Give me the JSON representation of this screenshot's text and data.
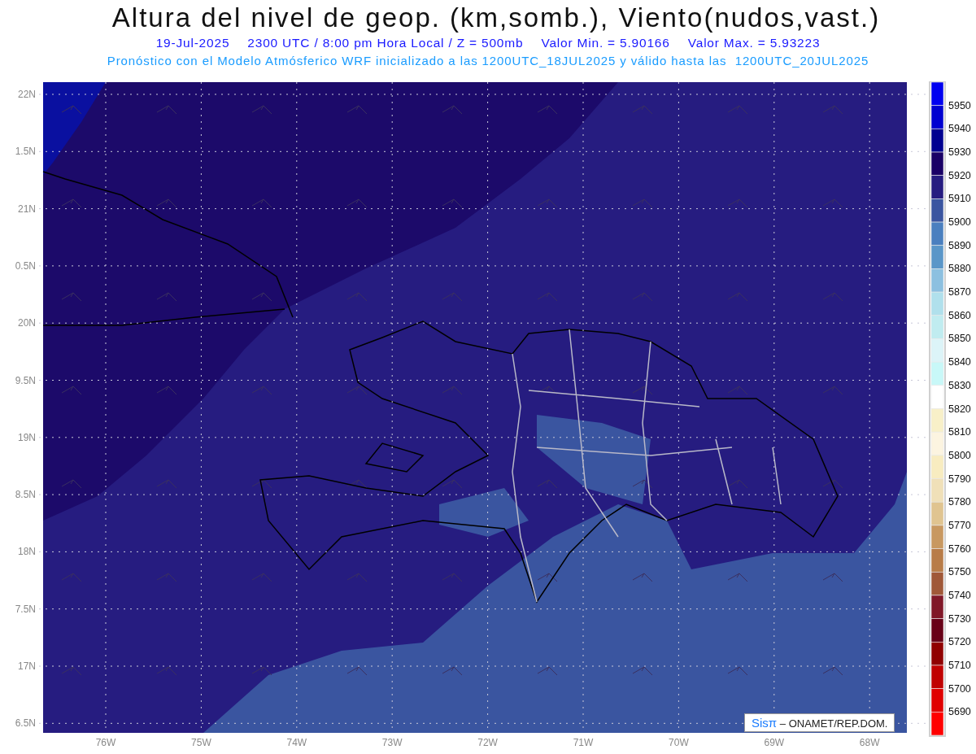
{
  "title": "Altura del nivel de geop. (km,somb.), Viento(nudos,vast.)",
  "info_line": [
    "19-Jul-2025",
    "2300 UTC / 8:00 pm Hora Local / Z = 500mb",
    "Valor Min. = 5.90166",
    "Valor Max. = 5.93223"
  ],
  "model_line": "Pronóstico con el Modelo Atmósferico WRF inicializado a las 1200UTC_18JUL2025 y válido hasta las  1200UTC_20JUL2025",
  "map": {
    "lat_labels": [
      "22N",
      "1.5N",
      "21N",
      "0.5N",
      "20N",
      "9.5N",
      "19N",
      "8.5N",
      "18N",
      "7.5N",
      "17N",
      "6.5N"
    ],
    "lon_labels": [
      "76W",
      "75W",
      "74W",
      "73W",
      "72W",
      "71W",
      "70W",
      "69W",
      "68W"
    ],
    "credit": {
      "logo": "Sisπ",
      "text": "– ONAMET/REP.DOM."
    }
  },
  "colorbar": {
    "bins": [
      {
        "color": "#0000f0"
      },
      {
        "color": "#0000d0"
      },
      {
        "color": "#000090"
      },
      {
        "color": "#1a0066"
      },
      {
        "color": "#261c80"
      },
      {
        "color": "#3a55a0"
      },
      {
        "color": "#4a7fbf"
      },
      {
        "color": "#5a96c8"
      },
      {
        "color": "#8cc0e0"
      },
      {
        "color": "#b0e0ec"
      },
      {
        "color": "#c0ecf0"
      },
      {
        "color": "#dcf4f8"
      },
      {
        "color": "#c8f8f8"
      },
      {
        "color": "#ffffff"
      },
      {
        "color": "#f8f0c8"
      },
      {
        "color": "#fcf4e0"
      },
      {
        "color": "#f8ecc0"
      },
      {
        "color": "#f0e0b8"
      },
      {
        "color": "#e0c490"
      },
      {
        "color": "#c89860"
      },
      {
        "color": "#b87c48"
      },
      {
        "color": "#a05838"
      },
      {
        "color": "#801828"
      },
      {
        "color": "#680018"
      },
      {
        "color": "#900000"
      },
      {
        "color": "#c00000"
      },
      {
        "color": "#e00000"
      },
      {
        "color": "#ff0000"
      }
    ],
    "labels": [
      "5950",
      "5940",
      "5930",
      "5920",
      "5910",
      "5900",
      "5890",
      "5880",
      "5870",
      "5860",
      "5850",
      "5840",
      "5830",
      "5820",
      "5810",
      "5800",
      "5790",
      "5780",
      "5770",
      "5760",
      "5750",
      "5740",
      "5730",
      "5720",
      "5710",
      "5700",
      "5690"
    ]
  }
}
